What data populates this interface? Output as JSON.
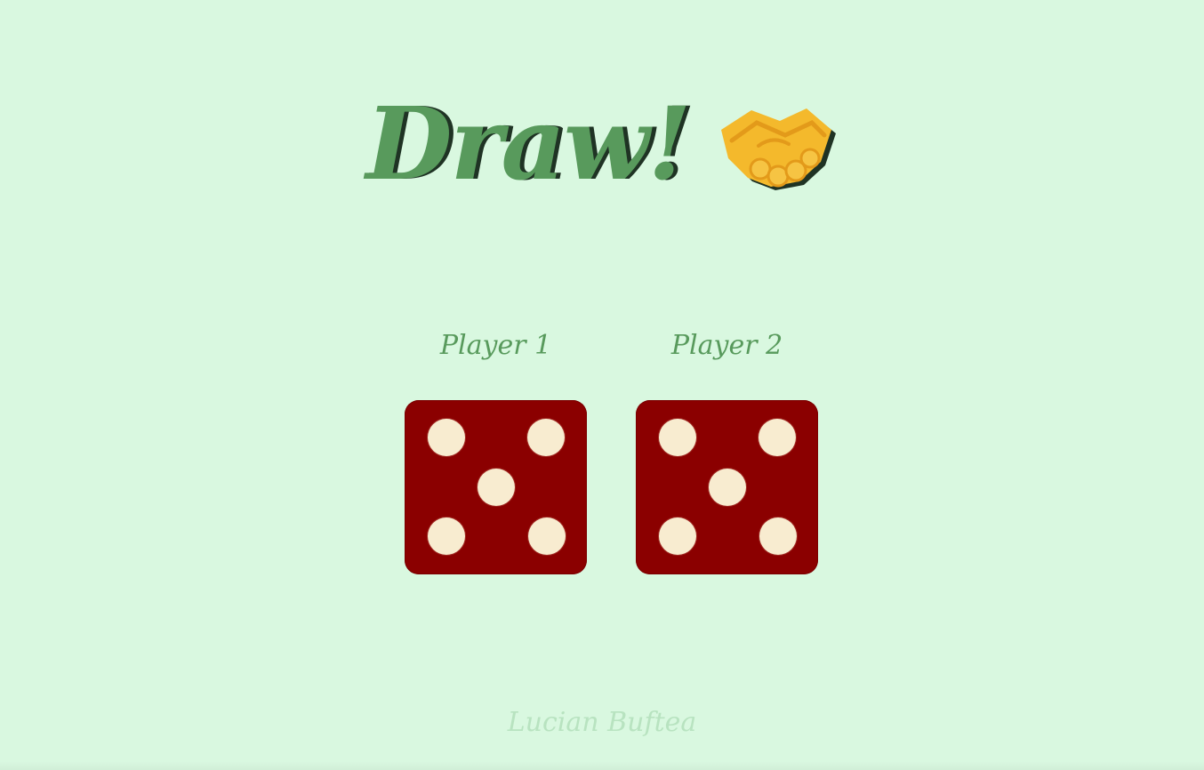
{
  "title": {
    "text": "Draw!",
    "icon": "handshake-icon"
  },
  "players": [
    {
      "label": "Player 1",
      "die_value": 5
    },
    {
      "label": "Player 2",
      "die_value": 5
    }
  ],
  "footer": {
    "author": "Lucian Buftea"
  },
  "colors": {
    "background": "#d9f8e0",
    "title_green": "#589a5c",
    "title_shadow": "#1f3324",
    "die_red": "#8b0000",
    "pip_cream": "#f8ecd0",
    "footer_text": "#b8e3c0"
  }
}
